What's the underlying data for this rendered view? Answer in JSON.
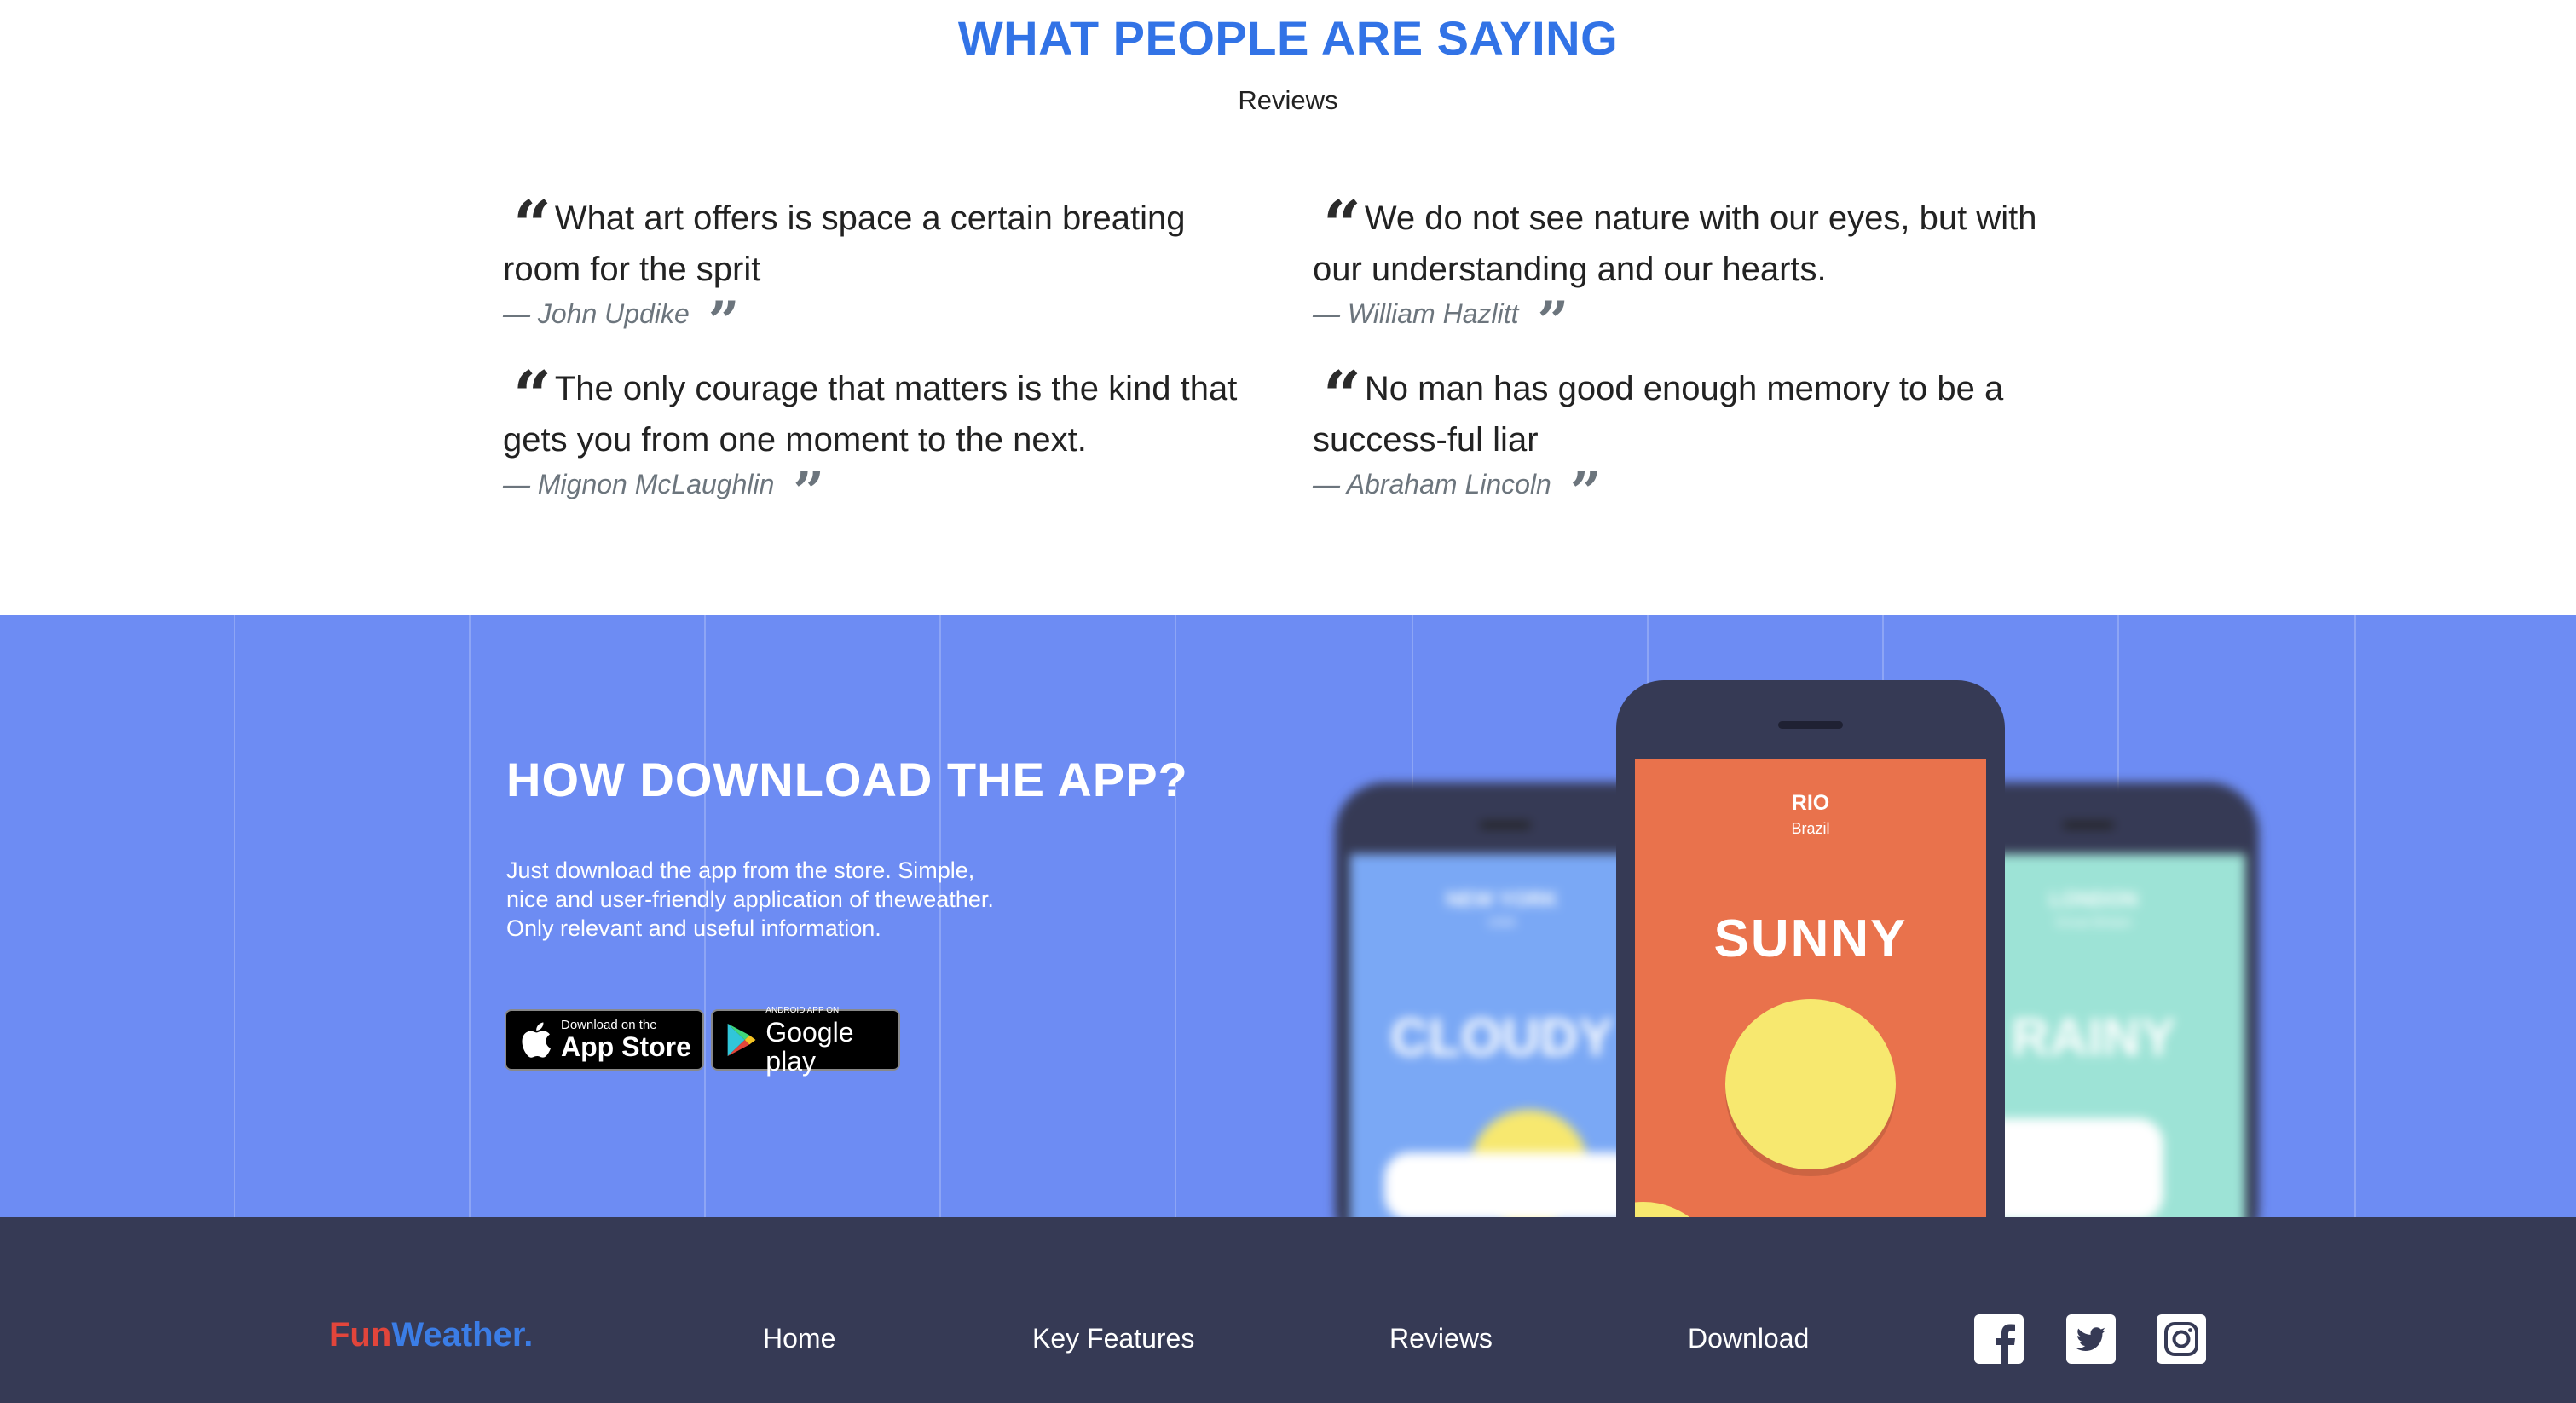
{
  "reviews": {
    "title": "WHAT PEOPLE ARE SAYING",
    "subtitle": "Reviews",
    "quotes": [
      {
        "text": "What art offers is space a certain breating room for the sprit",
        "author": "— John Updike"
      },
      {
        "text": "We do not see nature with our eyes, but with our understanding and our hearts.",
        "author": "— William Hazlitt"
      },
      {
        "text": "The only courage that matters is the kind that gets you from one moment to the next.",
        "author": "— Mignon McLaughlin"
      },
      {
        "text": "No man has good enough memory to be a success-ful liar",
        "author": "— Abraham Lincoln"
      }
    ]
  },
  "download": {
    "title": "HOW DOWNLOAD THE APP?",
    "text": "Just download the app from the store. Simple, nice and user-friendly application of theweather. Only relevant and useful information.",
    "app_store": {
      "small": "Download on the",
      "big": "App Store"
    },
    "google_play": {
      "small": "ANDROID APP ON",
      "big": "Google play"
    },
    "phones": {
      "left": {
        "city": "NEW YORK",
        "country": "USA",
        "weather": "CLOUDY",
        "color": "#7aa8f5"
      },
      "center": {
        "city": "RIO",
        "country": "Brazil",
        "weather": "SUNNY",
        "color": "#e9724c"
      },
      "right": {
        "city": "LONDON",
        "country": "Great Britain",
        "weather": "RAINY",
        "color": "#9de3d6"
      }
    }
  },
  "footer": {
    "logo_fun": "Fun",
    "logo_weather": "Weather.",
    "nav": [
      "Home",
      "Key Features",
      "Reviews",
      "Download"
    ],
    "social": [
      "facebook-icon",
      "twitter-icon",
      "instagram-icon"
    ]
  },
  "colors": {
    "accent": "#3273e6",
    "download_bg": "#6d8cf3",
    "footer_bg": "#363a55",
    "logo_fun": "#e2453b",
    "logo_weather": "#3b7de6"
  }
}
